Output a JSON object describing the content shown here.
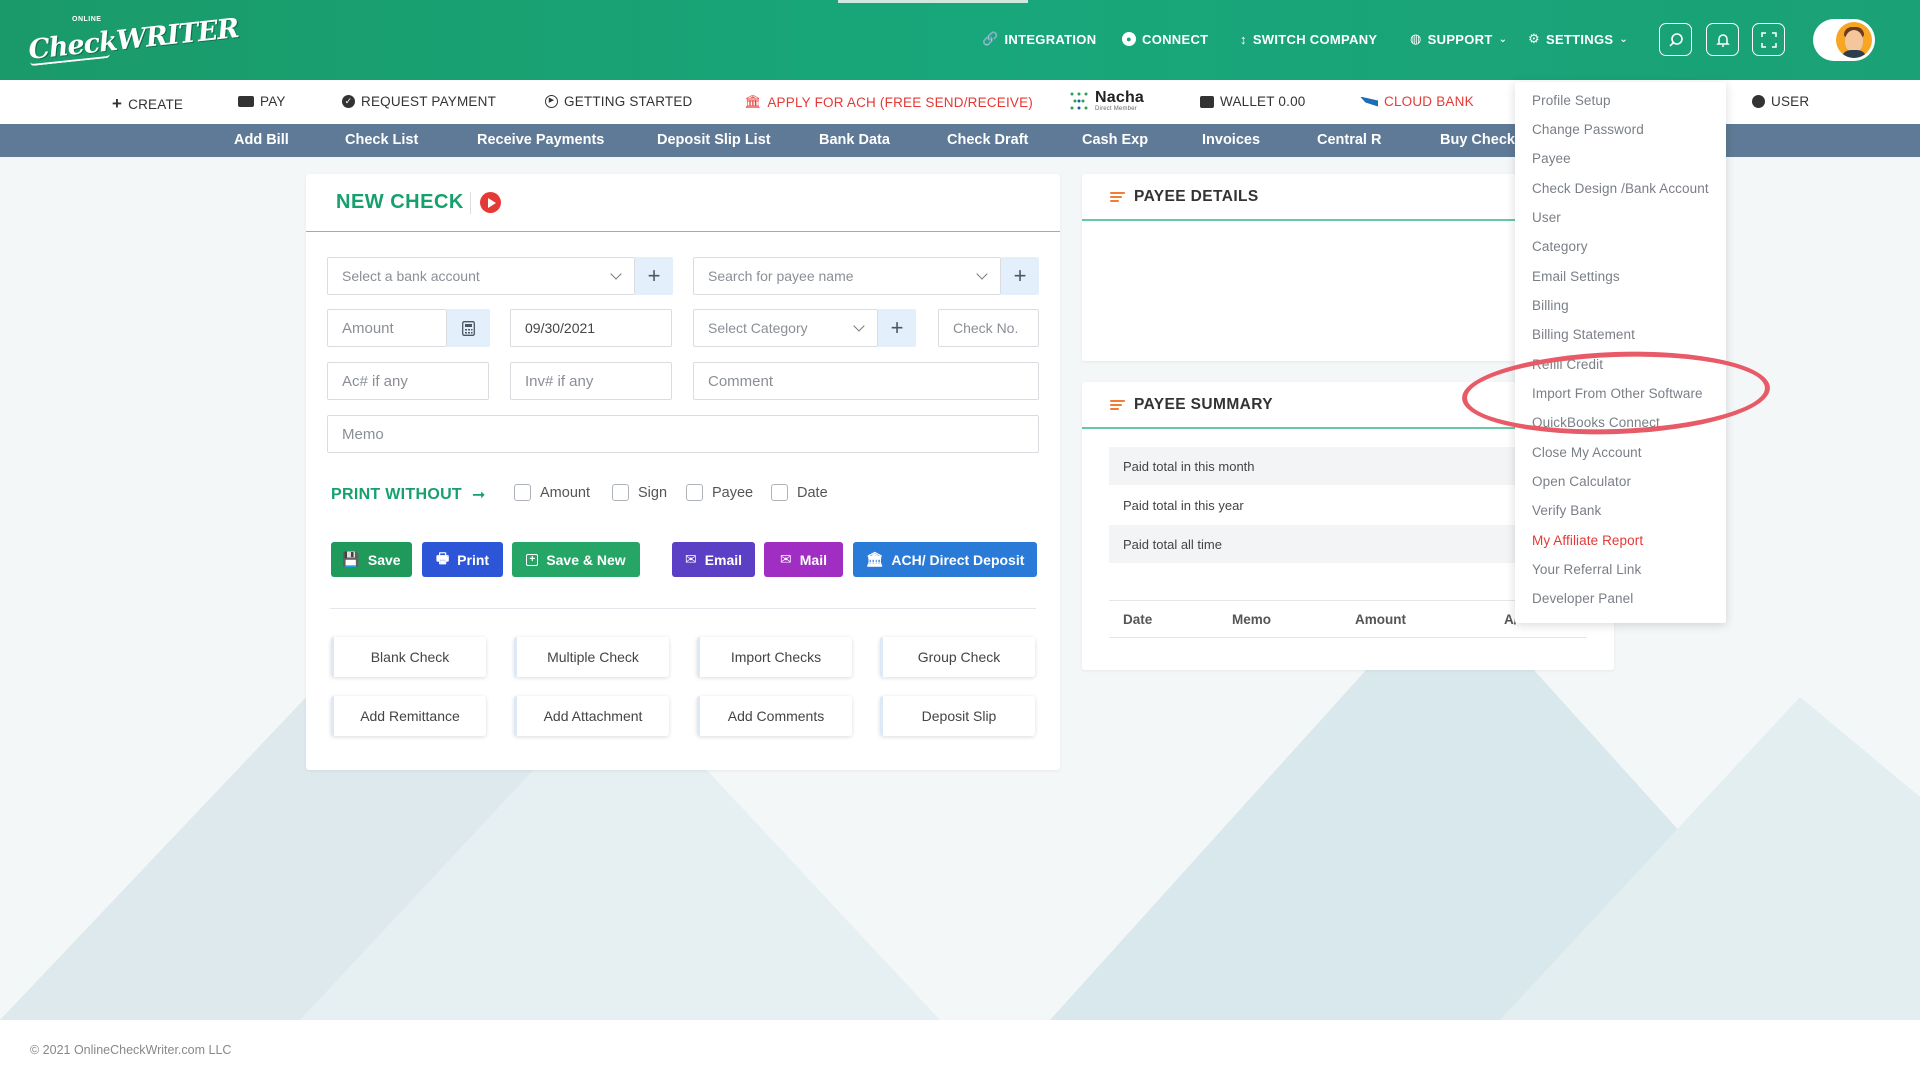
{
  "header": {
    "logo_small": "ONLINE",
    "logo_big": "CheckWRITER",
    "nav": [
      {
        "label": "INTEGRATION",
        "icon": "link-icon"
      },
      {
        "label": "CONNECT",
        "icon": "connect-icon"
      },
      {
        "label": "SWITCH COMPANY",
        "icon": "switch-icon"
      },
      {
        "label": "SUPPORT",
        "icon": "globe-icon"
      },
      {
        "label": "SETTINGS",
        "icon": "gear-icon"
      }
    ]
  },
  "subnav": {
    "create": "CREATE",
    "pay": "PAY",
    "request_payment": "REQUEST PAYMENT",
    "getting_started": "GETTING STARTED",
    "apply_ach": "APPLY FOR ACH (FREE SEND/RECEIVE)",
    "nacha": "Nacha",
    "nacha_sub": "Direct Member",
    "wallet": "WALLET 0.00",
    "cloud_bank": "CLOUD BANK",
    "user": "USER"
  },
  "bluebar": [
    "Add Bill",
    "Check List",
    "Receive Payments",
    "Deposit Slip List",
    "Bank Data",
    "Check Draft",
    "Cash Exp",
    "Invoices",
    "Central R",
    "Buy Check"
  ],
  "new_check": {
    "title": "NEW CHECK",
    "bank_placeholder": "Select a bank account",
    "payee_placeholder": "Search for payee name",
    "amount_placeholder": "Amount",
    "date_value": "09/30/2021",
    "category_placeholder": "Select Category",
    "check_no_placeholder": "Check No.",
    "ac_placeholder": "Ac# if any",
    "inv_placeholder": "Inv# if any",
    "comment_placeholder": "Comment",
    "memo_placeholder": "Memo",
    "print_without": "PRINT WITHOUT",
    "checkboxes": [
      "Amount",
      "Sign",
      "Payee",
      "Date"
    ],
    "buttons": {
      "save": "Save",
      "print": "Print",
      "save_new": "Save & New",
      "email": "Email",
      "mail": "Mail",
      "ach": "ACH/ Direct Deposit"
    },
    "options": [
      "Blank Check",
      "Multiple Check",
      "Import Checks",
      "Group Check",
      "Add Remittance",
      "Add Attachment",
      "Add Comments",
      "Deposit Slip"
    ]
  },
  "payee_details": {
    "title": "PAYEE DETAILS"
  },
  "payee_summary": {
    "title": "PAYEE SUMMARY",
    "rows": [
      "Paid total in this month",
      "Paid total in this year",
      "Paid total all time"
    ],
    "columns": [
      "Date",
      "Memo",
      "Amount",
      "A/"
    ]
  },
  "settings_menu": [
    "Profile Setup",
    "Change Password",
    "Payee",
    "Check Design /Bank Account",
    "User",
    "Category",
    "Email Settings",
    "Billing",
    "Billing Statement",
    "Refill Credit",
    "Import From Other Software",
    "QuickBooks Connect",
    "Close My Account",
    "Open Calculator",
    "Verify Bank",
    "My Affiliate Report",
    "Your Referral Link",
    "Developer Panel"
  ],
  "footer": "© 2021 OnlineCheckWriter.com LLC",
  "colors": {
    "brand_green": "#18a77a",
    "nav_blue": "#5f7a96",
    "accent_red": "#e53935"
  }
}
